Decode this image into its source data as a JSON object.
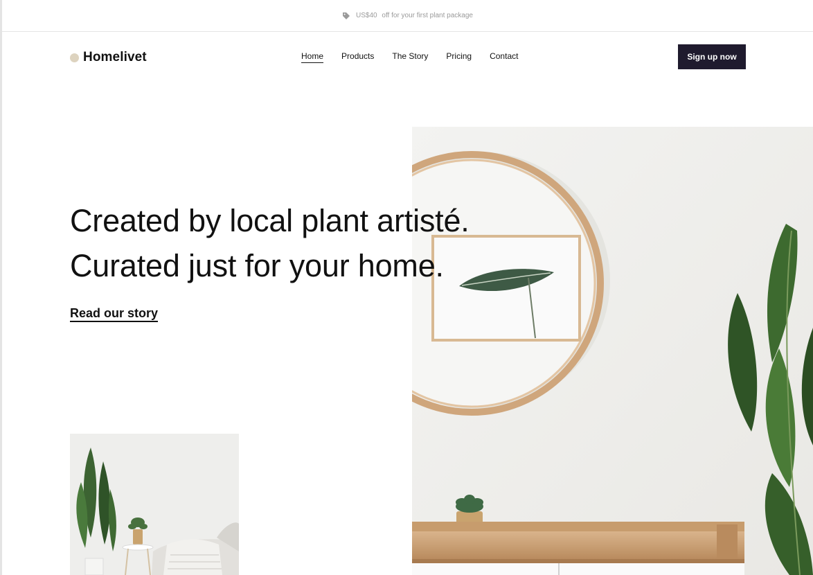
{
  "promo": {
    "icon": "tag-icon",
    "amount": "US$40",
    "text": "off for your first plant package"
  },
  "header": {
    "brand": "Homelivet",
    "brand_color": "#ddd3bf",
    "nav": [
      {
        "label": "Home",
        "active": true
      },
      {
        "label": "Products",
        "active": false
      },
      {
        "label": "The Story",
        "active": false
      },
      {
        "label": "Pricing",
        "active": false
      },
      {
        "label": "Contact",
        "active": false
      }
    ],
    "cta_label": "Sign up now",
    "cta_color": "#1f1b2e"
  },
  "hero": {
    "title_line1": "Created by local plant artisté.",
    "title_line2": "Curated just for your home.",
    "link_label": "Read our story"
  }
}
